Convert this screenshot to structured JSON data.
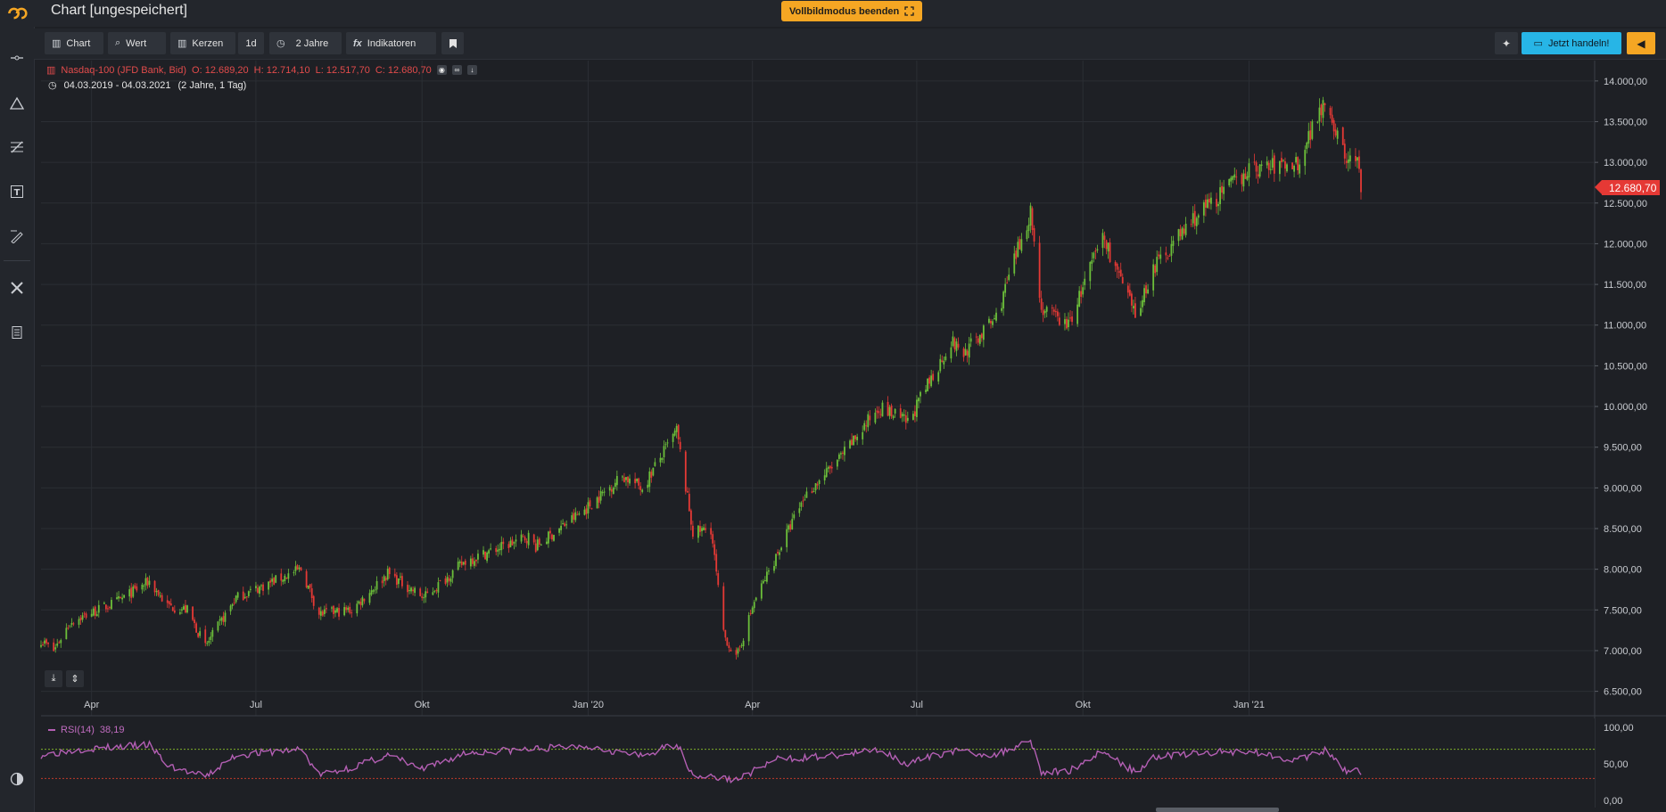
{
  "app": {
    "title": "Chart [ungespeichert]",
    "fullscreen_label": "Vollbildmodus beenden"
  },
  "toolbar": {
    "chart_label": "Chart",
    "value_label": "Wert",
    "candles_label": "Kerzen",
    "interval_label": "1d",
    "range_label": "2 Jahre",
    "indicators_label": "Indikatoren",
    "trade_label": "Jetzt handeln!"
  },
  "instrument": {
    "name": "Nasdaq-100 (JFD Bank, Bid)",
    "open": "O: 12.689,20",
    "high": "H: 12.714,10",
    "low": "L: 12.517,70",
    "close": "C: 12.680,70",
    "period": "04.03.2019 - 04.03.2021",
    "period_desc": "(2 Jahre, 1 Tag)",
    "last_price": "12.680,70"
  },
  "rsi": {
    "label": "RSI(14)",
    "value": "38,19"
  },
  "colors": {
    "up": "#6cbf3a",
    "down": "#e53935",
    "rsi_line": "#b45fb4",
    "accent": "#f5a623",
    "trade": "#27b5e6"
  },
  "icons": {
    "logo": "brand-logo-icon",
    "line_tool": "line-tool-icon",
    "shape_tool": "triangle-tool-icon",
    "fib_tool": "fib-tool-icon",
    "text_tool": "text-tool-icon",
    "pen_tool": "pen-tool-icon",
    "settings_tool": "tools-icon",
    "calculator": "calculator-icon",
    "theme": "theme-toggle-icon"
  },
  "chart_data": {
    "type": "candlestick",
    "y_ticks": [
      "14.000,00",
      "13.500,00",
      "13.000,00",
      "12.500,00",
      "12.000,00",
      "11.500,00",
      "11.000,00",
      "10.500,00",
      "10.000,00",
      "9.500,00",
      "9.000,00",
      "8.500,00",
      "8.000,00",
      "7.500,00",
      "7.000,00",
      "6.500,00"
    ],
    "y_tick_values": [
      14000,
      13500,
      13000,
      12500,
      12000,
      11500,
      11000,
      10500,
      10000,
      9500,
      9000,
      8500,
      8000,
      7500,
      7000,
      6500
    ],
    "x_ticks": [
      "Apr",
      "Jul",
      "Okt",
      "Jan '20",
      "Apr",
      "Jul",
      "Okt",
      "Jan '21"
    ],
    "x_tick_dates": [
      "2019-04-01",
      "2019-07-01",
      "2019-10-01",
      "2020-01-01",
      "2020-04-01",
      "2020-07-01",
      "2020-10-01",
      "2021-01-01"
    ],
    "ylim": [
      6200,
      14250
    ],
    "x_range": [
      "2019-03-04",
      "2021-03-04"
    ],
    "price_path": [
      [
        "2019-03-04",
        7130
      ],
      [
        "2019-03-11",
        7000
      ],
      [
        "2019-03-20",
        7350
      ],
      [
        "2019-04-15",
        7600
      ],
      [
        "2019-05-03",
        7850
      ],
      [
        "2019-05-13",
        7550
      ],
      [
        "2019-05-24",
        7500
      ],
      [
        "2019-06-03",
        7050
      ],
      [
        "2019-06-20",
        7650
      ],
      [
        "2019-07-26",
        8000
      ],
      [
        "2019-08-05",
        7450
      ],
      [
        "2019-08-23",
        7500
      ],
      [
        "2019-09-12",
        7950
      ],
      [
        "2019-10-02",
        7650
      ],
      [
        "2019-10-25",
        8100
      ],
      [
        "2019-11-29",
        8400
      ],
      [
        "2019-12-03",
        8280
      ],
      [
        "2019-12-31",
        8750
      ],
      [
        "2020-01-20",
        9150
      ],
      [
        "2020-01-31",
        9000
      ],
      [
        "2020-02-19",
        9700
      ],
      [
        "2020-02-28",
        8450
      ],
      [
        "2020-03-09",
        8500
      ],
      [
        "2020-03-16",
        7200
      ],
      [
        "2020-03-23",
        6900
      ],
      [
        "2020-04-02",
        7600
      ],
      [
        "2020-04-30",
        8900
      ],
      [
        "2020-05-21",
        9400
      ],
      [
        "2020-06-10",
        10000
      ],
      [
        "2020-06-26",
        9800
      ],
      [
        "2020-07-20",
        10800
      ],
      [
        "2020-07-27",
        10650
      ],
      [
        "2020-08-14",
        11100
      ],
      [
        "2020-09-02",
        12400
      ],
      [
        "2020-09-08",
        11200
      ],
      [
        "2020-09-23",
        11000
      ],
      [
        "2020-10-12",
        12100
      ],
      [
        "2020-10-30",
        11100
      ],
      [
        "2020-11-09",
        11700
      ],
      [
        "2020-12-01",
        12300
      ],
      [
        "2020-12-31",
        12900
      ],
      [
        "2021-01-28",
        13000
      ],
      [
        "2021-02-12",
        13800
      ],
      [
        "2021-02-24",
        13000
      ],
      [
        "2021-03-01",
        13100
      ],
      [
        "2021-03-04",
        12680
      ]
    ],
    "rsi_ticks": [
      "100,00",
      "50,00",
      "0,00"
    ],
    "rsi_tick_values": [
      100,
      50,
      0
    ],
    "rsi_overbought": 70,
    "rsi_oversold": 30,
    "rsi_path": [
      [
        "2019-03-04",
        62
      ],
      [
        "2019-03-25",
        70
      ],
      [
        "2019-04-15",
        73
      ],
      [
        "2019-05-03",
        76
      ],
      [
        "2019-05-13",
        48
      ],
      [
        "2019-06-03",
        32
      ],
      [
        "2019-06-20",
        62
      ],
      [
        "2019-07-26",
        70
      ],
      [
        "2019-08-05",
        35
      ],
      [
        "2019-08-23",
        45
      ],
      [
        "2019-09-12",
        62
      ],
      [
        "2019-10-02",
        42
      ],
      [
        "2019-10-25",
        65
      ],
      [
        "2019-11-29",
        70
      ],
      [
        "2019-12-31",
        75
      ],
      [
        "2020-01-31",
        60
      ],
      [
        "2020-02-19",
        78
      ],
      [
        "2020-02-28",
        35
      ],
      [
        "2020-03-16",
        30
      ],
      [
        "2020-03-23",
        28
      ],
      [
        "2020-04-14",
        56
      ],
      [
        "2020-05-21",
        62
      ],
      [
        "2020-06-10",
        70
      ],
      [
        "2020-06-26",
        50
      ],
      [
        "2020-07-20",
        68
      ],
      [
        "2020-08-14",
        62
      ],
      [
        "2020-09-02",
        84
      ],
      [
        "2020-09-08",
        38
      ],
      [
        "2020-09-23",
        40
      ],
      [
        "2020-10-12",
        68
      ],
      [
        "2020-10-30",
        38
      ],
      [
        "2020-11-09",
        60
      ],
      [
        "2020-12-01",
        64
      ],
      [
        "2020-12-31",
        68
      ],
      [
        "2021-01-28",
        55
      ],
      [
        "2021-02-12",
        68
      ],
      [
        "2021-02-24",
        40
      ],
      [
        "2021-03-01",
        46
      ],
      [
        "2021-03-04",
        38
      ]
    ]
  }
}
